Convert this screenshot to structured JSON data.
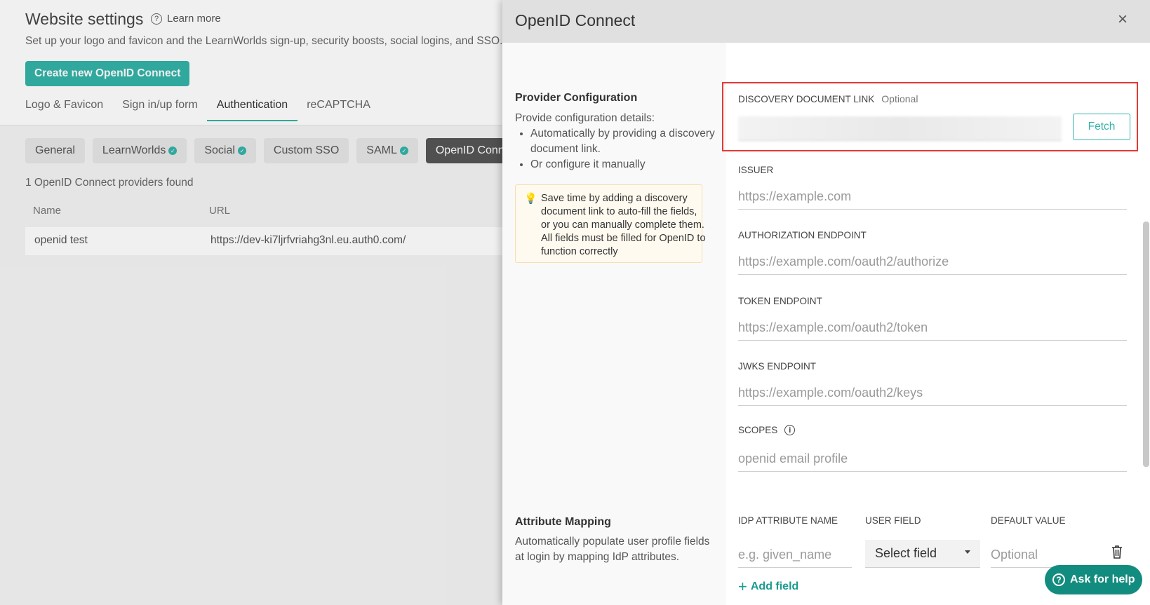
{
  "background": {
    "title": "Website settings",
    "learn_more": "Learn more",
    "subtitle": "Set up your logo and favicon and the LearnWorlds sign-up, security boosts, social logins, and SSO.",
    "create_button": "Create new OpenID Connect",
    "main_tabs": [
      "Logo & Favicon",
      "Sign in/up form",
      "Authentication",
      "reCAPTCHA"
    ],
    "sub_tabs": [
      "General",
      "LearnWorlds",
      "Social",
      "Custom SSO",
      "SAML",
      "OpenID Conne"
    ],
    "found_text": "1 OpenID Connect providers found",
    "table": {
      "headers": [
        "Name",
        "URL"
      ],
      "rows": [
        {
          "name": "openid test",
          "url": "https://dev-ki7ljrfvriahg3nl.eu.auth0.com/"
        }
      ]
    }
  },
  "drawer": {
    "title": "OpenID Connect",
    "close_icon": "×",
    "provider": {
      "title": "Provider Configuration",
      "intro": "Provide configuration details:",
      "bullets": [
        "Automatically by providing a discovery document link.",
        "Or configure it manually"
      ],
      "tip": "Save time by adding a discovery document link to auto-fill the fields, or you can manually complete them. All fields must be filled for OpenID to function correctly"
    },
    "fields": {
      "discovery_label": "DISCOVERY DOCUMENT LINK",
      "discovery_optional": "Optional",
      "fetch_label": "Fetch",
      "issuer_label": "ISSUER",
      "issuer_placeholder": "https://example.com",
      "auth_label": "AUTHORIZATION ENDPOINT",
      "auth_placeholder": "https://example.com/oauth2/authorize",
      "token_label": "TOKEN ENDPOINT",
      "token_placeholder": "https://example.com/oauth2/token",
      "jwks_label": "JWKS ENDPOINT",
      "jwks_placeholder": "https://example.com/oauth2/keys",
      "scopes_label": "SCOPES",
      "scopes_placeholder": "openid email profile"
    },
    "mapping": {
      "title": "Attribute Mapping",
      "description": "Automatically populate user profile fields at login by mapping IdP attributes.",
      "col_idp": "IDP ATTRIBUTE NAME",
      "col_user": "USER FIELD",
      "col_default": "DEFAULT VALUE",
      "idp_placeholder": "e.g. given_name",
      "select_value": "Select field",
      "default_placeholder": "Optional",
      "add_field": "Add field"
    },
    "ask_help": "Ask for help"
  }
}
